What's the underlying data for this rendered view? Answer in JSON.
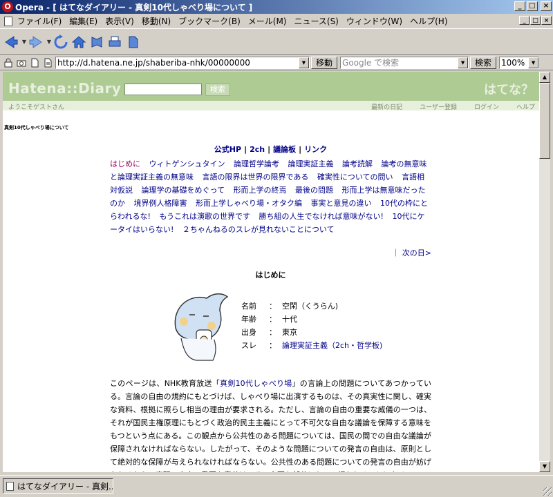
{
  "window": {
    "title": "Opera - [ はてなダイアリー - 真剣10代しゃべり場について ]",
    "minimize": "_",
    "maximize": "□",
    "close": "×"
  },
  "menu": {
    "items": [
      "ファイル(F)",
      "編集(E)",
      "表示(V)",
      "移動(N)",
      "ブックマーク(B)",
      "メール(M)",
      "ニュース(S)",
      "ウィンドウ(W)",
      "ヘルプ(H)"
    ]
  },
  "address_bar": {
    "url": "http://d.hatena.ne.jp/shaberiba-nhk/00000000",
    "go_label": "移動",
    "search_placeholder": "Google で検索",
    "search_label": "検索",
    "zoom": "100%"
  },
  "hatena": {
    "logo": "Hatena::Diary",
    "search_button": "検索",
    "brand_right": "はてな？",
    "welcome": "ようこそゲストさん",
    "links": [
      "最新の日記",
      "ユーザー登録",
      "ログイン",
      "ヘルプ"
    ]
  },
  "page": {
    "tiny_title": "真剣10代しゃべり場について",
    "top_links": [
      "公式HP",
      "2ch",
      "議論板",
      "リンク"
    ],
    "toc": [
      "はじめに",
      "ウィトゲンシュタイン",
      "論理哲学論考",
      "論理実証主義",
      "論考読解",
      "論考の無意味と論理実証主義の無意味",
      "言語の限界は世界の限界である",
      "確実性についての問い",
      "言語相対仮説",
      "論理学の基礎をめぐって",
      "形而上学の終焉",
      "最後の問題",
      "形而上学は無意味だったのか",
      "境界例人格障害",
      "形而上学しゃべり場・オタク編",
      "事実と意見の違い",
      "10代の枠にとらわれるな!",
      "もうこれは演歌の世界です",
      "勝ち組の人生でなければ意味がない!",
      "10代にケータイはいらない!",
      "２ちゃんねるのスレが見れないことについて"
    ],
    "next_day": "｜ 次の日>",
    "section_title": "はじめに",
    "profile": [
      {
        "key": "名前",
        "value": "空閑（くうらん)"
      },
      {
        "key": "年齢",
        "value": "十代"
      },
      {
        "key": "出身",
        "value": "東京"
      },
      {
        "key": "スレ",
        "value": "論理実証主義（2ch・哲学板)"
      }
    ],
    "body_before_link": "このページは、NHK教育放送「",
    "body_link": "真剣10代しゃべり場",
    "body_after_link": "」の言論上の問題についてあつかっている。言論の自由の規約にもとづけば、しゃべり場に出演するものは、その真実性に関し、確実な資料、根拠に照らし相当の理由が要求される。ただし、言論の自由の重要な威儀の一つは、それが国民主権原理にもとづく政治的民主主義にとって不可欠な自由な議論を保障する意味をもつという点にある。この観点から公共性のある問題については、国民の間での自由な議論が保障されなければならない。したがって、そのような問題についての発言の自由は、原則として絶対的な保障が与えられなければならない。公共性のある問題についての発言の自由が妨げられるなら、表現の自由の重要な意義は、その主要な部分において損われることになる。"
  },
  "status": {
    "tab_label": "はてなダイアリー - 真剣..."
  }
}
